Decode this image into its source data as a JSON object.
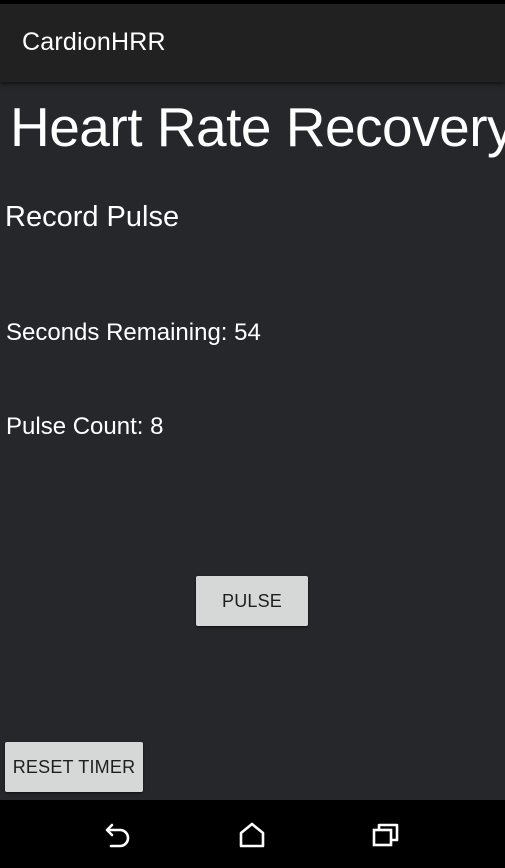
{
  "app_bar": {
    "title": "CardionHRR"
  },
  "main": {
    "heading": "Heart Rate Recovery",
    "subheading": "Record Pulse",
    "seconds_remaining_label": "Seconds Remaining:",
    "seconds_remaining_value": "54",
    "pulse_count_label": "Pulse Count:",
    "pulse_count_value": "8",
    "pulse_button_label": "PULSE",
    "reset_button_label": "RESET TIMER"
  },
  "nav_bar": {
    "icons": [
      "back-icon",
      "home-icon",
      "recent-apps-icon"
    ]
  },
  "colors": {
    "background": "#26272b",
    "app_bar": "#212121",
    "button": "#d6d7d7",
    "text": "#ffffff"
  }
}
